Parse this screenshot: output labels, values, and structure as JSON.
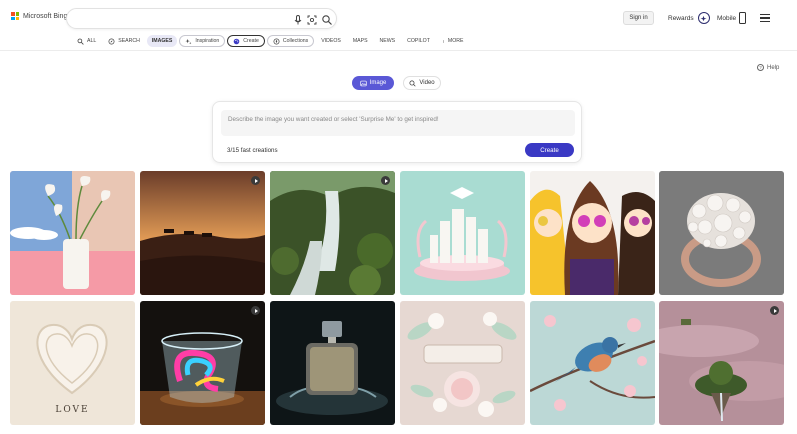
{
  "header": {
    "brand": "Microsoft Bing",
    "search_value": "",
    "signin_label": "Sign in",
    "rewards_label": "Rewards",
    "mobile_label": "Mobile"
  },
  "nav": [
    {
      "label": "ALL",
      "icon": "search-icon"
    },
    {
      "label": "SEARCH",
      "icon": "compass-icon"
    },
    {
      "label": "IMAGES",
      "icon": ""
    },
    {
      "label": "Inspiration",
      "icon": "sparkle-icon"
    },
    {
      "label": "Create",
      "icon": "palette-icon"
    },
    {
      "label": "Collections",
      "icon": "collections-icon"
    },
    {
      "label": "VIDEOS",
      "icon": ""
    },
    {
      "label": "MAPS",
      "icon": ""
    },
    {
      "label": "NEWS",
      "icon": ""
    },
    {
      "label": "COPILOT",
      "icon": ""
    },
    {
      "label": "MORE",
      "icon": "more-dots-icon"
    }
  ],
  "help_label": "Help",
  "mode_toggle": {
    "image_label": "Image",
    "video_label": "Video"
  },
  "prompt": {
    "placeholder": "Describe the image you want created or select 'Surprise Me' to get inspired!",
    "counter": "3/15 fast creations",
    "create_label": "Create"
  },
  "gallery": [
    {
      "subject": "calla lilies vase",
      "video": false
    },
    {
      "subject": "desert camels sunset",
      "video": true
    },
    {
      "subject": "forest waterfall",
      "video": true
    },
    {
      "subject": "graduation paper city",
      "video": false
    },
    {
      "subject": "anime friends",
      "video": false
    },
    {
      "subject": "pearl ring",
      "video": false
    },
    {
      "subject": "heart love",
      "video": false,
      "caption": "LOVE"
    },
    {
      "subject": "glass with swirl",
      "video": true
    },
    {
      "subject": "perfume bottle",
      "video": false
    },
    {
      "subject": "summer floral",
      "video": false
    },
    {
      "subject": "bird on blossom",
      "video": false
    },
    {
      "subject": "floating island",
      "video": true
    }
  ],
  "colors": {
    "accent": "#5a58d6",
    "create_button": "#3a39c4",
    "active_tab": "#e8e8f6"
  }
}
